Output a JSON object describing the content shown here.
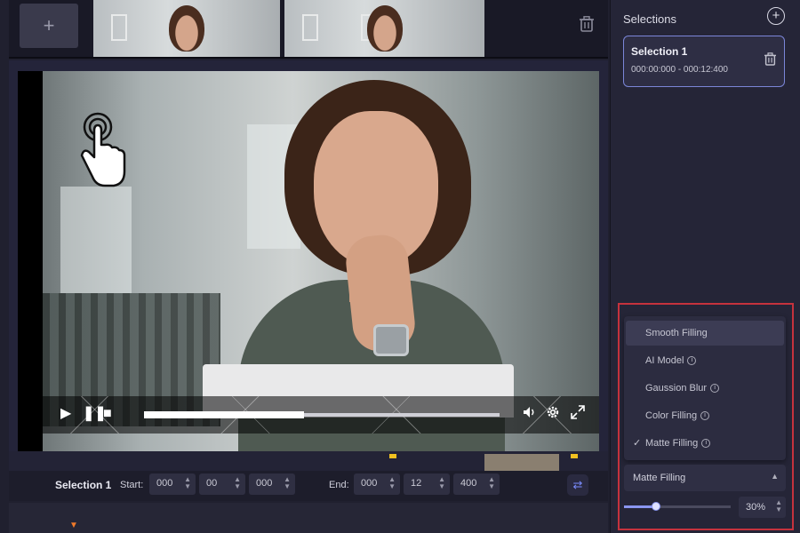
{
  "thumbnails": {
    "add_label": "+",
    "trash_icon": "trash-icon"
  },
  "player": {
    "progress": 0.45,
    "icons": [
      "play-icon",
      "pause-icon",
      "stop-icon",
      "volume-icon",
      "gear-icon",
      "fullscreen-icon"
    ]
  },
  "selection_row": {
    "name": "Selection 1",
    "start_label": "Start:",
    "start": [
      "000",
      "00",
      "000"
    ],
    "end_label": "End:",
    "end": [
      "000",
      "12",
      "400"
    ]
  },
  "sidebar": {
    "title": "Selections",
    "selection": {
      "name": "Selection 1",
      "time": "000:00:000 - 000:12:400"
    }
  },
  "fill": {
    "options": [
      {
        "label": "Smooth Filling",
        "info": false,
        "active": true,
        "checked": false
      },
      {
        "label": "AI Model",
        "info": true,
        "active": false,
        "checked": false
      },
      {
        "label": "Gaussion Blur",
        "info": true,
        "active": false,
        "checked": false
      },
      {
        "label": "Color Filling",
        "info": true,
        "active": false,
        "checked": false
      },
      {
        "label": "Matte Filling",
        "info": true,
        "active": false,
        "checked": true
      }
    ],
    "selected": "Matte Filling",
    "opacity_value": 0.3,
    "opacity_text": "30%"
  },
  "colors": {
    "accent": "#8a96f0",
    "highlight_border": "#c5323d",
    "marker": "#f0c020"
  }
}
